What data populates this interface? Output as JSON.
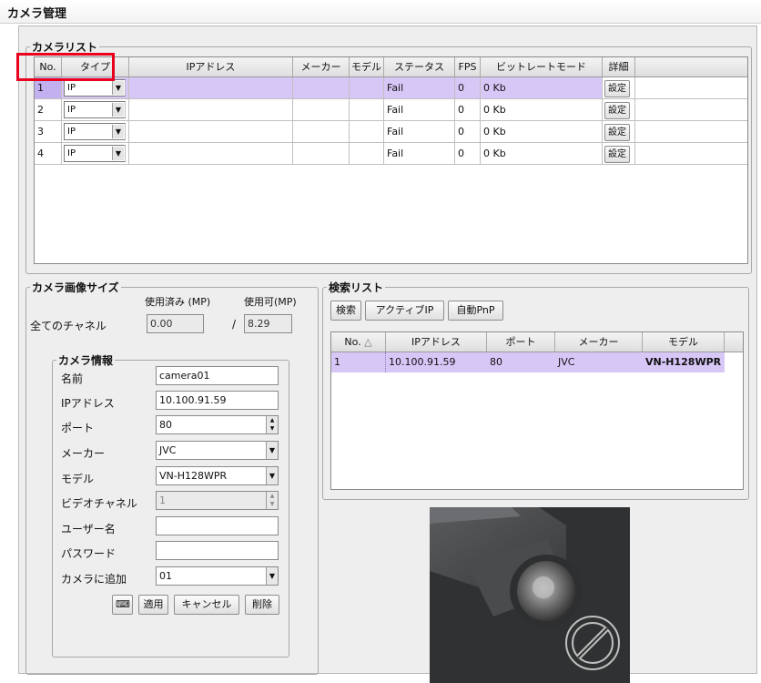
{
  "window": {
    "title": "カメラ管理"
  },
  "camera_list": {
    "legend": "カメラリスト",
    "columns": [
      "No.",
      "タイプ",
      "IPアドレス",
      "メーカー",
      "モデル",
      "ステータス",
      "FPS",
      "ビットレートモード",
      "詳細"
    ],
    "rows": [
      {
        "no": "1",
        "type": "IP",
        "ip": "",
        "maker": "",
        "model": "",
        "status": "Fail",
        "fps": "0",
        "bitrate": "0 Kb",
        "detail": "設定"
      },
      {
        "no": "2",
        "type": "IP",
        "ip": "",
        "maker": "",
        "model": "",
        "status": "Fail",
        "fps": "0",
        "bitrate": "0 Kb",
        "detail": "設定"
      },
      {
        "no": "3",
        "type": "IP",
        "ip": "",
        "maker": "",
        "model": "",
        "status": "Fail",
        "fps": "0",
        "bitrate": "0 Kb",
        "detail": "設定"
      },
      {
        "no": "4",
        "type": "IP",
        "ip": "",
        "maker": "",
        "model": "",
        "status": "Fail",
        "fps": "0",
        "bitrate": "0 Kb",
        "detail": "設定"
      }
    ]
  },
  "image_size": {
    "legend": "カメラ画像サイズ",
    "used_label": "使用済み (MP)",
    "available_label": "使用可(MP)",
    "all_channels_label": "全てのチャネル",
    "used_value": "0.00",
    "separator": "/",
    "available_value": "8.29"
  },
  "camera_info": {
    "legend": "カメラ情報",
    "name_label": "名前",
    "name_value": "camera01",
    "ip_label": "IPアドレス",
    "ip_value": "10.100.91.59",
    "port_label": "ポート",
    "port_value": "80",
    "maker_label": "メーカー",
    "maker_value": "JVC",
    "model_label": "モデル",
    "model_value": "VN-H128WPR",
    "video_channel_label": "ビデオチャネル",
    "video_channel_value": "1",
    "user_label": "ユーザー名",
    "user_value": "",
    "password_label": "パスワード",
    "password_value": "",
    "add_to_camera_label": "カメラに追加",
    "add_to_camera_value": "01",
    "buttons": {
      "keyboard": "⌨",
      "apply": "適用",
      "cancel": "キャンセル",
      "delete": "削除"
    }
  },
  "search_list": {
    "legend": "検索リスト",
    "buttons": {
      "search": "検索",
      "active_ip": "アクティブIP",
      "auto_pnp": "自動PnP"
    },
    "columns": [
      "No.",
      "IPアドレス",
      "ポート",
      "メーカー",
      "モデル"
    ],
    "sort_indicator": "△",
    "rows": [
      {
        "no": "1",
        "ip": "10.100.91.59",
        "port": "80",
        "maker": "JVC",
        "model": "VN-H128WPR"
      }
    ]
  },
  "colors": {
    "selection": "#d7c7f7",
    "highlight_box": "#e8001c",
    "panel_bg": "#eeeeee"
  },
  "icons": {
    "dropdown": "chevron-down-icon",
    "keyboard": "keyboard-icon",
    "no_camera": "prohibited-icon"
  }
}
